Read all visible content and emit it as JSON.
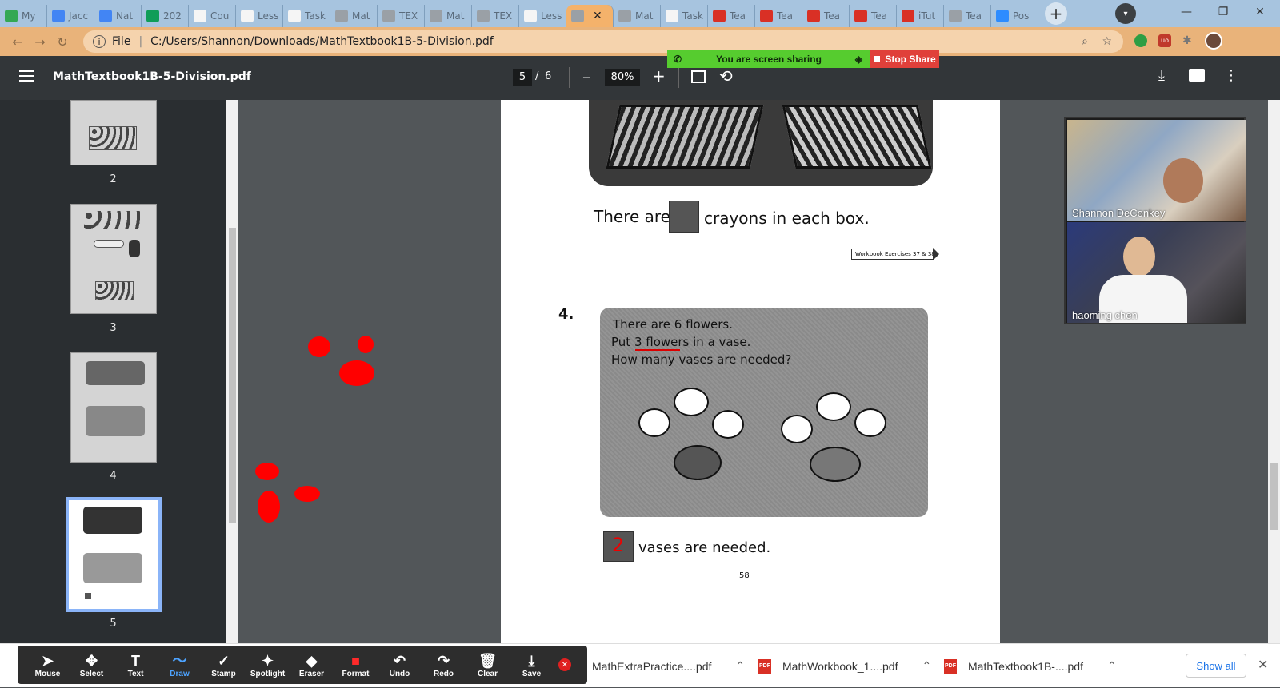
{
  "tabs": [
    {
      "label": "My",
      "color": "#34a853"
    },
    {
      "label": "Jacc",
      "color": "#4285f4"
    },
    {
      "label": "Nat",
      "color": "#4285f4"
    },
    {
      "label": "202",
      "color": "#0f9d58"
    },
    {
      "label": "Cou",
      "color": "#f5f5f5"
    },
    {
      "label": "Less",
      "color": "#f5f5f5"
    },
    {
      "label": "Task",
      "color": "#f5f5f5"
    },
    {
      "label": "Mat",
      "color": "#9aa0a6"
    },
    {
      "label": "TEX",
      "color": "#9aa0a6"
    },
    {
      "label": "Mat",
      "color": "#9aa0a6"
    },
    {
      "label": "TEX",
      "color": "#9aa0a6"
    },
    {
      "label": "Less",
      "color": "#f5f5f5"
    },
    {
      "label": "",
      "color": "#9aa0a6"
    },
    {
      "label": "Mat",
      "color": "#9aa0a6"
    },
    {
      "label": "Task",
      "color": "#f5f5f5"
    },
    {
      "label": "Tea",
      "color": "#d93025"
    },
    {
      "label": "Tea",
      "color": "#d93025"
    },
    {
      "label": "Tea",
      "color": "#d93025"
    },
    {
      "label": "Tea",
      "color": "#d93025"
    },
    {
      "label": "iTut",
      "color": "#d93025"
    },
    {
      "label": "Tea",
      "color": "#9aa0a6"
    },
    {
      "label": "Pos",
      "color": "#2d8cff"
    }
  ],
  "address": {
    "scheme": "File",
    "url": "C:/Users/Shannon/Downloads/MathTextbook1B-5-Division.pdf"
  },
  "pdf": {
    "filename": "MathTextbook1B-5-Division.pdf",
    "current_page": "5",
    "page_sep": "/",
    "total_pages": "6",
    "zoom": "80%"
  },
  "share": {
    "status": "You are screen sharing",
    "stop": "Stop Share"
  },
  "thumbnails": [
    "2",
    "3",
    "4",
    "5"
  ],
  "page": {
    "crayon_line_start": "There are",
    "crayon_line_end": "crayons in each box.",
    "workbook_ref": "Workbook Exercises 37 & 38",
    "question_number": "4.",
    "q_line1": "There are 6 flowers.",
    "q_line2": "Put 3 flowers in a vase.",
    "q_line3": "How many vases are needed?",
    "answer_mark": "2",
    "answer_text": "vases are needed.",
    "page_number": "58"
  },
  "participants": [
    {
      "name": "Shannon DeConkey"
    },
    {
      "name": "haoming chen"
    }
  ],
  "annotation_tools": [
    {
      "label": "Mouse",
      "glyph": "➤"
    },
    {
      "label": "Select",
      "glyph": "✥"
    },
    {
      "label": "Text",
      "glyph": "T"
    },
    {
      "label": "Draw",
      "glyph": "〜"
    },
    {
      "label": "Stamp",
      "glyph": "✓"
    },
    {
      "label": "Spotlight",
      "glyph": "✦"
    },
    {
      "label": "Eraser",
      "glyph": "◆"
    },
    {
      "label": "Format",
      "glyph": "■"
    },
    {
      "label": "Undo",
      "glyph": "↶"
    },
    {
      "label": "Redo",
      "glyph": "↷"
    },
    {
      "label": "Clear",
      "glyph": "🗑"
    },
    {
      "label": "Save",
      "glyph": "⤓"
    }
  ],
  "downloads": [
    {
      "name": "MathExtraPractice....pdf"
    },
    {
      "name": "MathWorkbook_1....pdf"
    },
    {
      "name": "MathTextbook1B-....pdf"
    }
  ],
  "show_all": "Show all",
  "pdf_icon_label": "PDF",
  "colors": {
    "accent_draw": "#4da3ff",
    "annotation_red": "#ff0000",
    "share_green": "#56cc2f",
    "share_red": "#e0403a"
  }
}
